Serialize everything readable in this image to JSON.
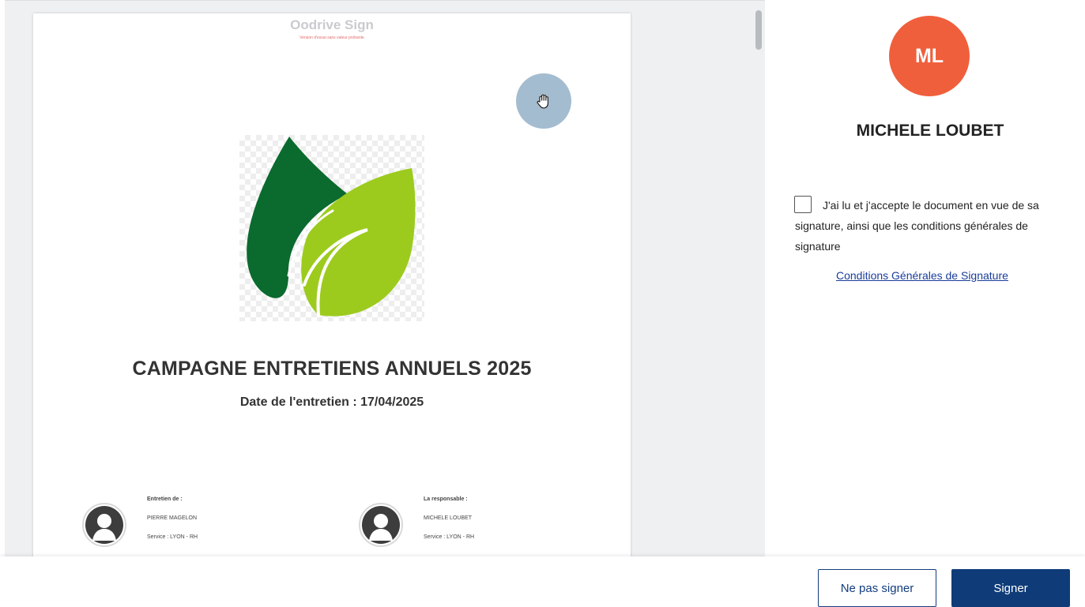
{
  "document": {
    "watermark_title": "Oodrive Sign",
    "watermark_subtitle": "Version d'essai sans valeur probante",
    "title": "CAMPAGNE ENTRETIENS ANNUELS 2025",
    "date_line": "Date de l'entretien : 17/04/2025",
    "participants": [
      {
        "role": "Entretien de :",
        "name": "PIERRE MAGELON",
        "service": "Service : LYON - RH"
      },
      {
        "role": "La responsable :",
        "name": "MICHELE LOUBET",
        "service": "Service : LYON - RH"
      }
    ]
  },
  "signer": {
    "initials": "ML",
    "name": "MICHELE LOUBET",
    "avatar_color": "#f05f3c"
  },
  "consent": {
    "text": "J'ai lu et j'accepte le document en vue de sa signature, ainsi que les conditions générales de signature",
    "checked": false,
    "link_label": "Conditions Générales de Signature"
  },
  "actions": {
    "decline_label": "Ne pas signer",
    "sign_label": "Signer"
  },
  "colors": {
    "primary": "#0f3c78",
    "link": "#1a3d9a",
    "leaf_dark": "#0b6a2e",
    "leaf_light": "#9ccb1e"
  },
  "icons": {
    "hand_tool": "hand-grab-icon",
    "participant_avatar": "user-avatar-icon"
  }
}
